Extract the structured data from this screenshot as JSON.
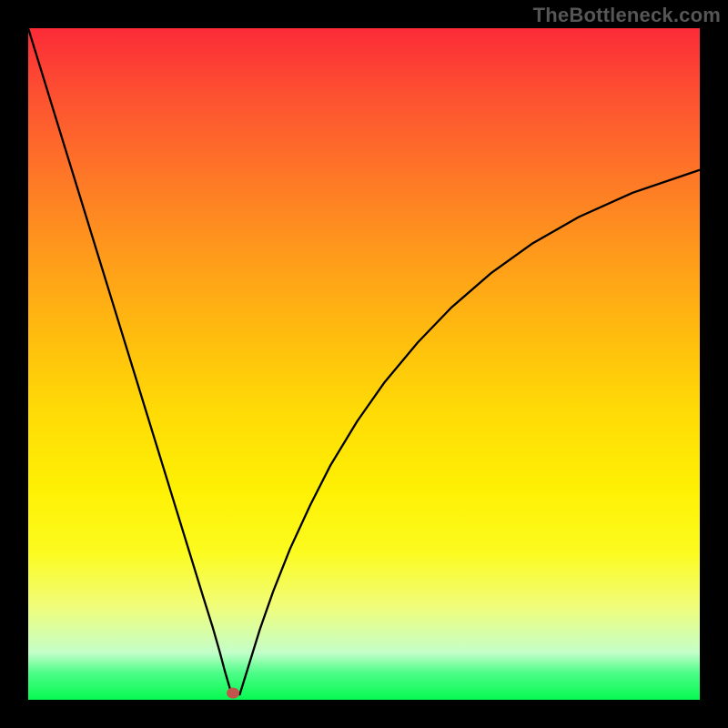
{
  "watermark": "TheBottleneck.com",
  "chart_data": {
    "type": "line",
    "title": "",
    "xlabel": "",
    "ylabel": "",
    "xlim": [
      0,
      100
    ],
    "ylim": [
      0,
      100
    ],
    "series": [
      {
        "name": "bottleneck-curve",
        "x": [
          0,
          2,
          4,
          6,
          8,
          10,
          12,
          14,
          16,
          18,
          20,
          22,
          24,
          26,
          27.5,
          28.5,
          29.3,
          30.3,
          31.5,
          32.8,
          34.5,
          36.5,
          39,
          42,
          45,
          49,
          53,
          58,
          63,
          69,
          75,
          82,
          90,
          100
        ],
        "y": [
          100,
          93.5,
          87,
          80.5,
          74,
          67.5,
          61,
          54.5,
          48,
          41.5,
          35,
          28.5,
          22,
          15.5,
          10.7,
          7.2,
          4.2,
          0.8,
          0.8,
          5,
          10.5,
          16.2,
          22.5,
          29,
          34.9,
          41.5,
          47.2,
          53.2,
          58.4,
          63.6,
          67.9,
          71.9,
          75.5,
          78.9
        ]
      }
    ],
    "marker": {
      "x": 30.5,
      "y": 1
    },
    "colors": {
      "curve": "#000000",
      "lead_in": "#0b8a34",
      "marker": "#c0554c"
    }
  }
}
